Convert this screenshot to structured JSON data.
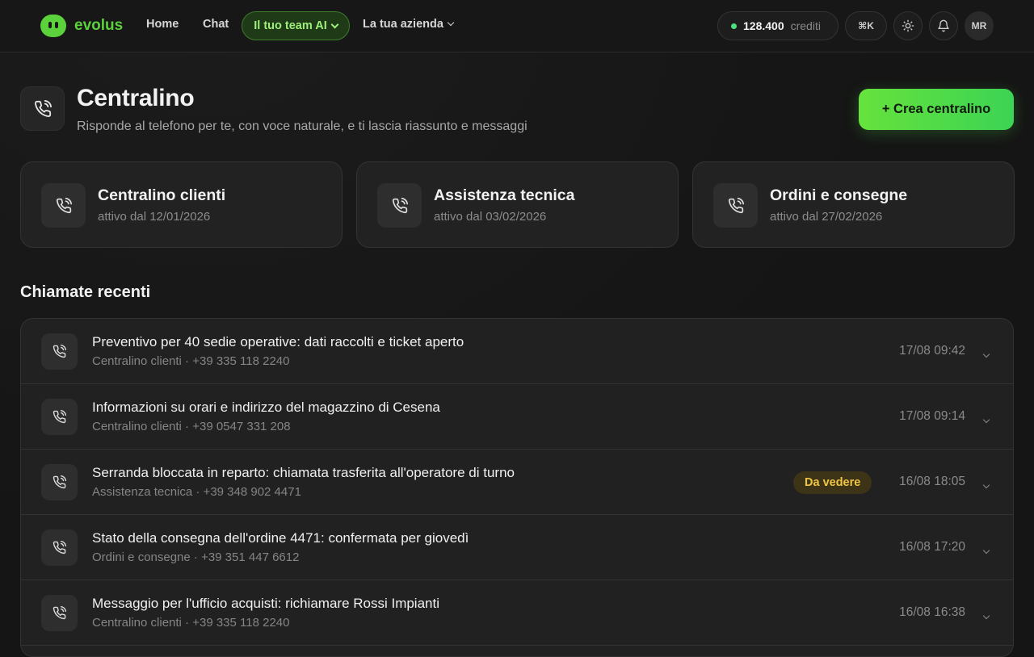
{
  "brand": {
    "name": "evolus",
    "accent": "#5bd13c"
  },
  "nav": {
    "home": "Home",
    "chat": "Chat",
    "team": "Il tuo team AI",
    "company": "La tua azienda"
  },
  "account": {
    "credits_value": "128.400",
    "credits_label": "crediti",
    "shortcut": "⌘K",
    "initials": "MR"
  },
  "page": {
    "icon": "phone-icon",
    "title": "Centralino",
    "subtitle": "Risponde al telefono per te, con voce naturale, e ti lascia riassunto e messaggi",
    "create_label": "+ Crea centralino"
  },
  "lines": [
    {
      "name": "Centralino clienti",
      "since": "attivo dal 12/01/2026"
    },
    {
      "name": "Assistenza tecnica",
      "since": "attivo dal 03/02/2026"
    },
    {
      "name": "Ordini e consegne",
      "since": "attivo dal 27/02/2026"
    }
  ],
  "recent": {
    "title": "Chiamate recenti",
    "calls": [
      {
        "title": "Preventivo per 40 sedie operative: dati raccolti e ticket aperto",
        "meta": "Centralino clienti · +39 335 118 2240",
        "time": "17/08 09:42",
        "badge": ""
      },
      {
        "title": "Informazioni su orari e indirizzo del magazzino di Cesena",
        "meta": "Centralino clienti · +39 0547 331 208",
        "time": "17/08 09:14",
        "badge": ""
      },
      {
        "title": "Serranda bloccata in reparto: chiamata trasferita all'operatore di turno",
        "meta": "Assistenza tecnica · +39 348 902 4471",
        "time": "16/08 18:05",
        "badge": "Da vedere"
      },
      {
        "title": "Stato della consegna dell'ordine 4471: confermata per giovedì",
        "meta": "Ordini e consegne · +39 351 447 6612",
        "time": "16/08 17:20",
        "badge": ""
      },
      {
        "title": "Messaggio per l'ufficio acquisti: richiamare Rossi Impianti",
        "meta": "Centralino clienti · +39 335 118 2240",
        "time": "16/08 16:38",
        "badge": ""
      }
    ]
  }
}
